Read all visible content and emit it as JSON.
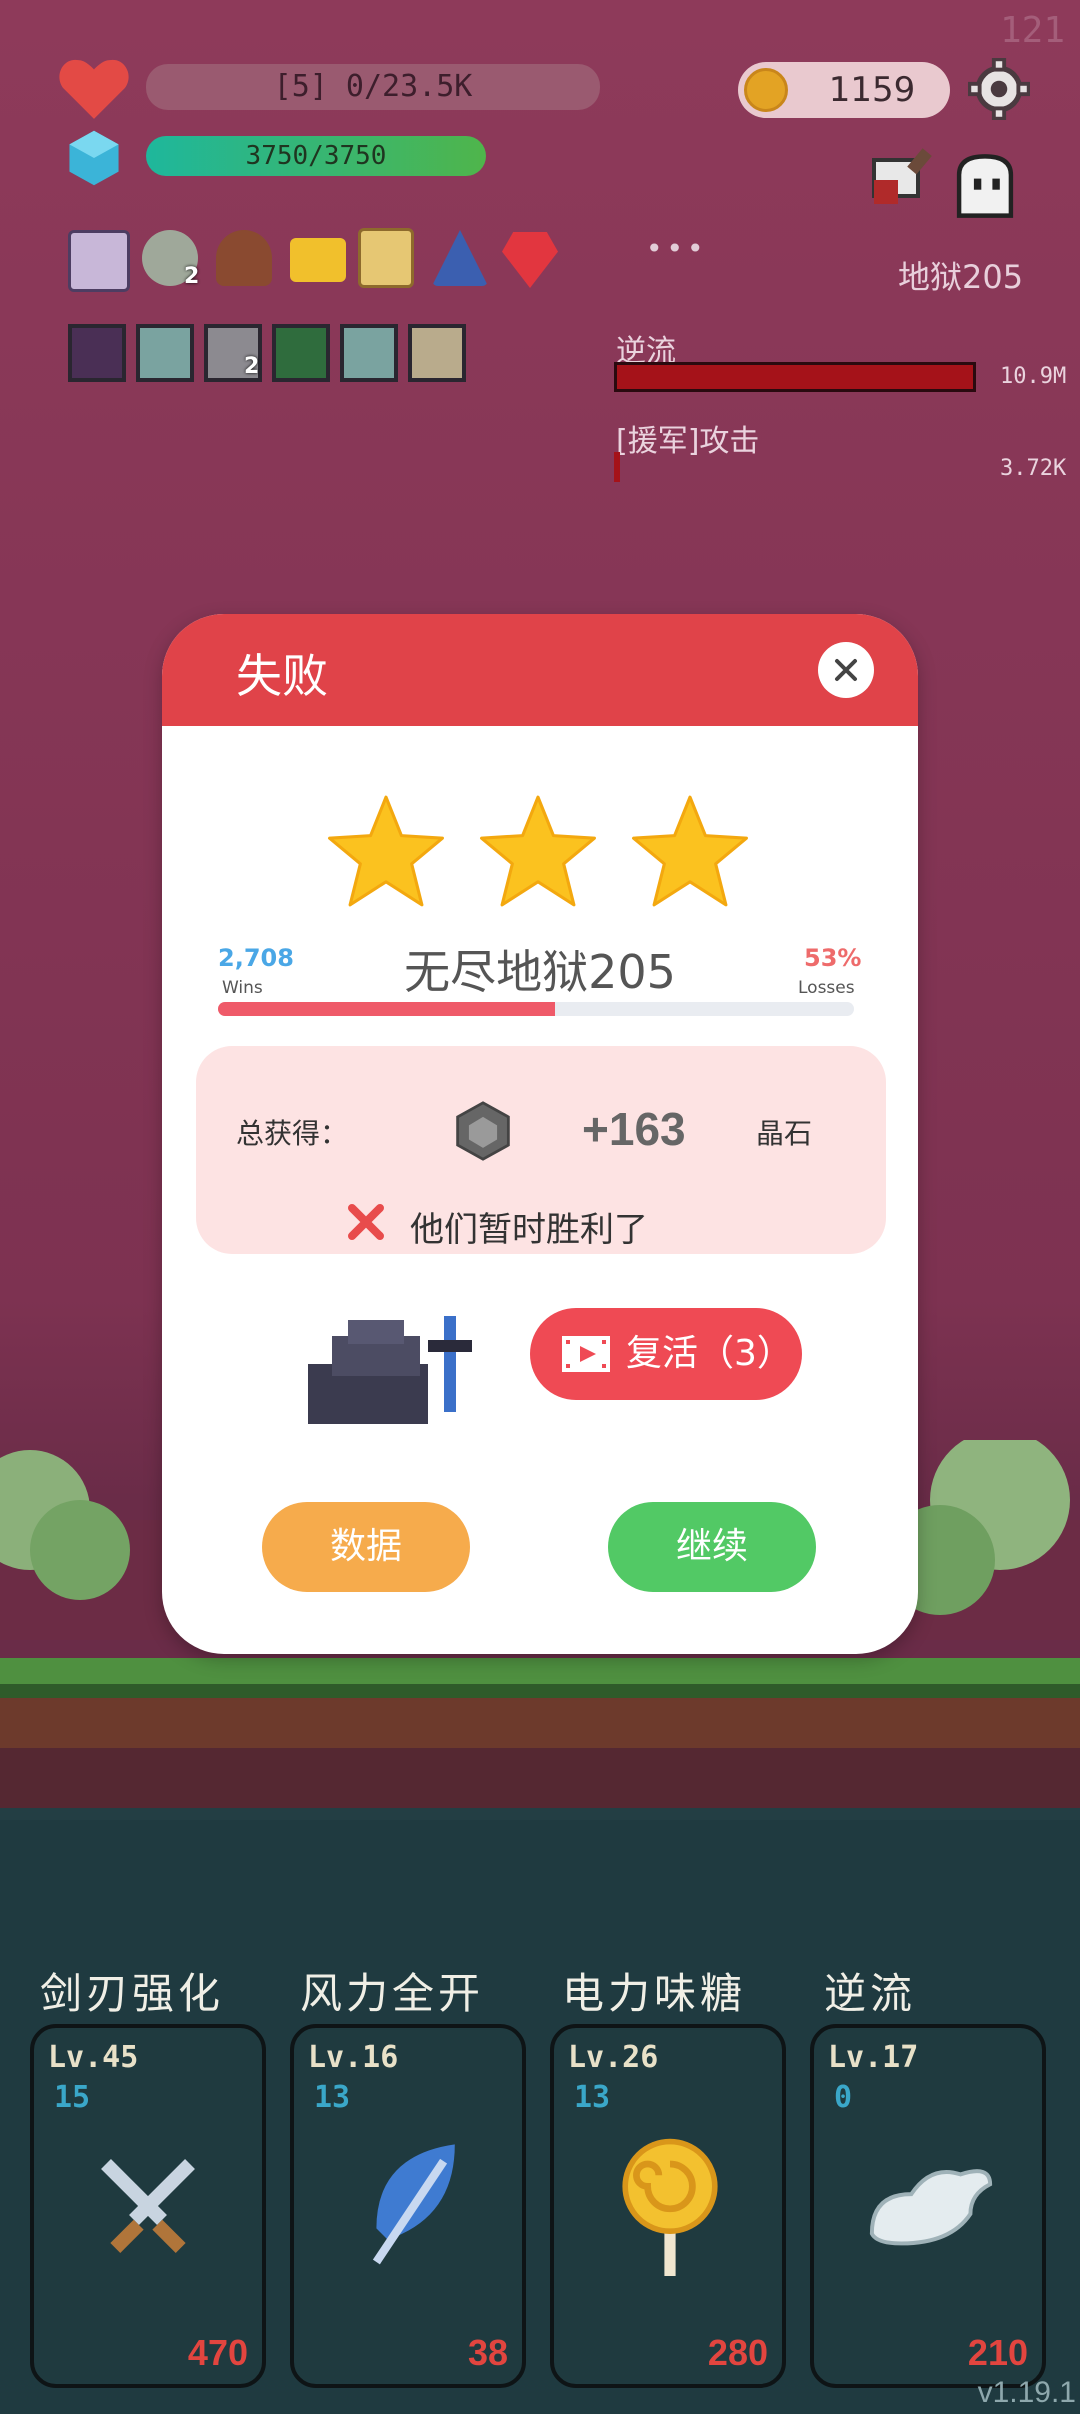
{
  "hud": {
    "hp_text": "[5] 0/23.5K",
    "shield_text": "3750/3750",
    "coins": "1159",
    "corner_counter": "121",
    "stage_label": "地狱205",
    "more_dots": "•••",
    "item_badge_1": "2",
    "item_badge_2": "2",
    "enemy_bars": [
      {
        "name": "逆流",
        "value": "10.9M",
        "fill": 1.0
      },
      {
        "name": "[援军]攻击",
        "value": "3.72K",
        "fill": 0.01
      }
    ]
  },
  "dialog": {
    "title": "失败",
    "stars": 3,
    "wins_value": "2,708",
    "wins_label": "Wins",
    "losses_value": "53%",
    "losses_label": "Losses",
    "stage_name": "无尽地狱205",
    "win_ratio": 0.53,
    "reward_label": "总获得：",
    "reward_amount": "+163",
    "reward_unit": "晶石",
    "defeat_text": "他们暂时胜利了",
    "revive_label": "复活（3）",
    "data_button": "数据",
    "continue_button": "继续"
  },
  "skills": [
    {
      "name": "剑刃强化",
      "level": "Lv.45",
      "sub": "15",
      "cost": "470"
    },
    {
      "name": "风力全开",
      "level": "Lv.16",
      "sub": "13",
      "cost": "38"
    },
    {
      "name": "电力味糖",
      "level": "Lv.26",
      "sub": "13",
      "cost": "280"
    },
    {
      "name": "逆流",
      "level": "Lv.17",
      "sub": "0",
      "cost": "210"
    }
  ],
  "version": "v1.19.1",
  "colors": {
    "accent_red": "#e04349",
    "orange": "#f6ab4c",
    "green": "#52c965",
    "panel_pink": "#fde3e3"
  }
}
